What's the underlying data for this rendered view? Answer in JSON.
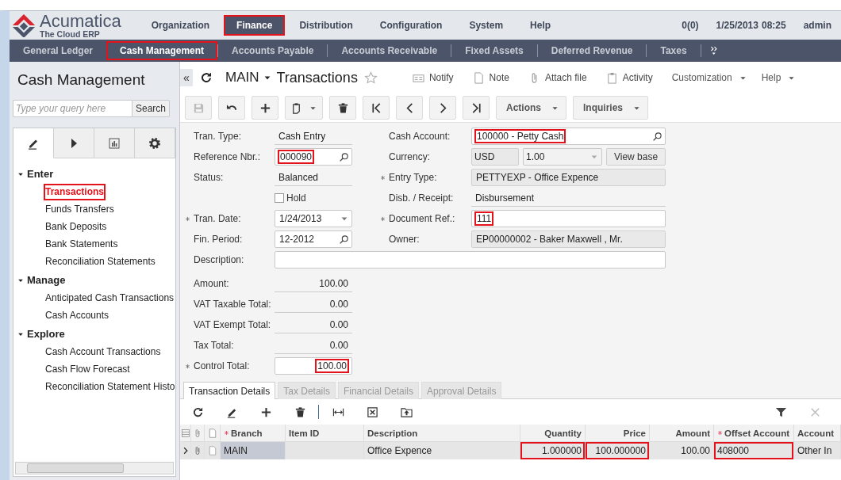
{
  "header": {
    "logo": {
      "title": "Acumatica",
      "subtitle": "The Cloud ERP"
    },
    "menu": [
      {
        "label": "Organization",
        "selected": false,
        "highlighted": false
      },
      {
        "label": "Finance",
        "selected": true,
        "highlighted": true
      },
      {
        "label": "Distribution",
        "selected": false,
        "highlighted": false
      },
      {
        "label": "Configuration",
        "selected": false,
        "highlighted": false
      },
      {
        "label": "System",
        "selected": false,
        "highlighted": false
      },
      {
        "label": "Help",
        "selected": false,
        "highlighted": false
      }
    ],
    "notifications": "0(0)",
    "date": "1/25/2013",
    "time": "08:25",
    "user": "admin"
  },
  "modules": [
    {
      "label": "General Ledger",
      "selected": false,
      "highlighted": false
    },
    {
      "label": "Cash Management",
      "selected": true,
      "highlighted": true
    },
    {
      "label": "Accounts Payable",
      "selected": false,
      "highlighted": false
    },
    {
      "label": "Accounts Receivable",
      "selected": false,
      "highlighted": false
    },
    {
      "label": "Fixed Assets",
      "selected": false,
      "highlighted": false
    },
    {
      "label": "Deferred Revenue",
      "selected": false,
      "highlighted": false
    },
    {
      "label": "Taxes",
      "selected": false,
      "highlighted": false
    }
  ],
  "sidebar": {
    "title": "Cash Management",
    "search": {
      "placeholder": "Type your query here",
      "button": "Search"
    },
    "tabs": [
      {
        "kind": "pencil",
        "selected": true
      },
      {
        "kind": "play",
        "selected": false
      },
      {
        "kind": "chart",
        "selected": false
      },
      {
        "kind": "gear",
        "selected": false
      }
    ],
    "tree": [
      {
        "label": "Enter",
        "expanded": true,
        "children": [
          {
            "label": "Transactions",
            "selected": true,
            "highlighted": true
          },
          {
            "label": "Funds Transfers",
            "selected": false,
            "highlighted": false
          },
          {
            "label": "Bank Deposits",
            "selected": false,
            "highlighted": false
          },
          {
            "label": "Bank Statements",
            "selected": false,
            "highlighted": false
          },
          {
            "label": "Reconciliation Statements",
            "selected": false,
            "highlighted": false
          }
        ]
      },
      {
        "label": "Manage",
        "expanded": true,
        "children": [
          {
            "label": "Anticipated Cash Transactions",
            "selected": false,
            "highlighted": false
          },
          {
            "label": "Cash Accounts",
            "selected": false,
            "highlighted": false
          }
        ]
      },
      {
        "label": "Explore",
        "expanded": true,
        "children": [
          {
            "label": "Cash Account Transactions",
            "selected": false,
            "highlighted": false
          },
          {
            "label": "Cash Flow Forecast",
            "selected": false,
            "highlighted": false
          },
          {
            "label": "Reconciliation Statement Histo",
            "selected": false,
            "highlighted": false
          }
        ]
      }
    ]
  },
  "page": {
    "collapse": "«",
    "company": "MAIN",
    "title": "Transactions",
    "links": [
      {
        "kind": "notify",
        "label": "Notify"
      },
      {
        "kind": "note",
        "label": "Note"
      },
      {
        "kind": "attach",
        "label": "Attach file"
      },
      {
        "kind": "activity",
        "label": "Activity"
      },
      {
        "kind": "menu",
        "label": "Customization"
      },
      {
        "kind": "menu",
        "label": "Help"
      }
    ],
    "toolbar": [
      {
        "kind": "save",
        "disabled": true
      },
      {
        "kind": "undo",
        "disabled": false
      },
      {
        "kind": "add",
        "disabled": false
      },
      {
        "kind": "copy",
        "disabled": false
      },
      {
        "kind": "delete",
        "disabled": false
      },
      {
        "kind": "first",
        "disabled": false
      },
      {
        "kind": "prev",
        "disabled": false
      },
      {
        "kind": "next",
        "disabled": false
      },
      {
        "kind": "last",
        "disabled": false
      },
      {
        "kind": "menu",
        "label": "Actions",
        "disabled": false
      },
      {
        "kind": "menu",
        "label": "Inquiries",
        "disabled": false
      }
    ]
  },
  "form": {
    "left": [
      {
        "kind": "text",
        "label": "Tran. Type:",
        "value": "Cash Entry",
        "required": false,
        "highlighted": false
      },
      {
        "kind": "lookup",
        "label": "Reference Nbr.:",
        "value": "000090",
        "required": false,
        "highlighted": true
      },
      {
        "kind": "text",
        "label": "Status:",
        "value": "Balanced",
        "required": false,
        "highlighted": false
      },
      {
        "kind": "checkbox",
        "value": "Hold",
        "checked": false,
        "required": false,
        "highlighted": false
      },
      {
        "kind": "dropdown",
        "label": "Tran. Date:",
        "value": "1/24/2013",
        "required": true,
        "highlighted": false
      },
      {
        "kind": "lookup",
        "label": "Fin. Period:",
        "value": "12-2012",
        "required": false,
        "highlighted": false
      }
    ],
    "right": [
      {
        "kind": "lookup",
        "label": "Cash Account:",
        "value": "100000 - Petty Cash",
        "required": false,
        "highlighted": true
      },
      {
        "kind": "currency",
        "label": "Currency:",
        "value": "USD",
        "rate": "1.00",
        "button": "View base",
        "required": false,
        "highlighted": false
      },
      {
        "kind": "readonly",
        "label": "Entry Type:",
        "value": "PETTYEXP - Office Expence",
        "required": true,
        "highlighted": false
      },
      {
        "kind": "text",
        "label": "Disb. / Receipt:",
        "value": "Disbursement",
        "required": false,
        "highlighted": false
      },
      {
        "kind": "input",
        "label": "Document Ref.:",
        "value": "111",
        "required": true,
        "highlighted": true
      },
      {
        "kind": "readonly",
        "label": "Owner:",
        "value": "EP00000002 - Baker Maxwell , Mr.",
        "required": false,
        "highlighted": false
      }
    ],
    "description": {
      "label": "Description:",
      "required": false,
      "highlighted": false
    },
    "totals": [
      {
        "kind": "amount",
        "label": "Amount:",
        "value": "100.00",
        "required": false,
        "highlighted": false
      },
      {
        "kind": "amount",
        "label": "VAT Taxable Total:",
        "value": "0.00",
        "required": false,
        "highlighted": false
      },
      {
        "kind": "amount",
        "label": "VAT Exempt Total:",
        "value": "0.00",
        "required": false,
        "highlighted": false
      },
      {
        "kind": "amount",
        "label": "Tax Total:",
        "value": "0.00",
        "required": false,
        "highlighted": false
      },
      {
        "kind": "input_amount",
        "label": "Control Total:",
        "value": "100.00",
        "required": true,
        "highlighted": true
      }
    ]
  },
  "tabs": [
    {
      "label": "Transaction Details",
      "selected": true
    },
    {
      "label": "Tax Details",
      "selected": false
    },
    {
      "label": "Financial Details",
      "selected": false
    },
    {
      "label": "Approval Details",
      "selected": false
    }
  ],
  "grid": {
    "toolbar": [
      {
        "kind": "refresh"
      },
      {
        "kind": "edit"
      },
      {
        "kind": "add"
      },
      {
        "kind": "delete"
      },
      {
        "kind": "fit"
      },
      {
        "kind": "excel"
      },
      {
        "kind": "upload"
      }
    ],
    "toolbar_right": [
      {
        "kind": "filter",
        "disabled": false
      },
      {
        "kind": "close",
        "disabled": true
      }
    ],
    "icon_columns": [
      {
        "kind": "lines"
      },
      {
        "kind": "attach"
      },
      {
        "kind": "note"
      }
    ],
    "columns": [
      {
        "label": "Branch",
        "required": true
      },
      {
        "label": "Item ID",
        "required": false
      },
      {
        "label": "Description",
        "required": false
      },
      {
        "label": "Quantity",
        "required": false
      },
      {
        "label": "Price",
        "required": false
      },
      {
        "label": "Amount",
        "required": false
      },
      {
        "label": "Offset Account",
        "required": true
      },
      {
        "label": "Account",
        "required": false
      }
    ],
    "rows": [
      {
        "selected": true,
        "cells": [
          {
            "text": "MAIN",
            "highlighted": false
          },
          {
            "highlighted": false
          },
          {
            "text": "Office Expence",
            "highlighted": false
          },
          {
            "text": "1.000000",
            "highlighted": true
          },
          {
            "text": "100.000000",
            "highlighted": true
          },
          {
            "text": "100.00",
            "highlighted": false
          },
          {
            "text": "408000",
            "highlighted": true
          },
          {
            "text": "Other In",
            "highlighted": false
          }
        ]
      }
    ]
  }
}
